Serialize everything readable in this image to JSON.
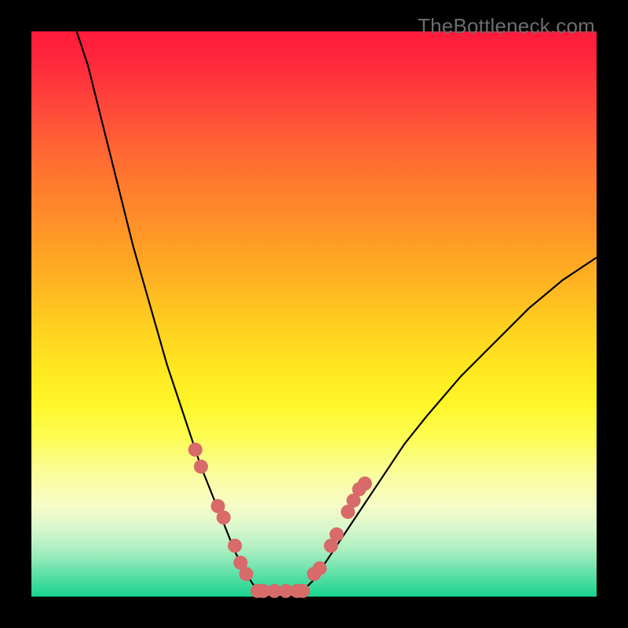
{
  "watermark": "TheBottleneck.com",
  "colors": {
    "frame_bg": "#000000",
    "marker_fill": "#d86a6a",
    "curve_stroke": "#000000"
  },
  "chart_data": {
    "type": "line",
    "title": "",
    "xlabel": "",
    "ylabel": "",
    "xlim": [
      0,
      100
    ],
    "ylim": [
      0,
      100
    ],
    "grid": false,
    "legend": false,
    "description": "V-shaped bottleneck curve with rainbow background; curve drops from top-left to a flat minimum near x≈40-48 at y≈0, then rises to the right. Pink markers are clustered on the two sides of the valley and along the flat minimum.",
    "series": [
      {
        "name": "bottleneck-curve",
        "x": [
          8,
          10,
          12,
          14,
          16,
          18,
          20,
          22,
          24,
          26,
          28,
          30,
          32,
          34,
          36,
          38,
          40,
          42,
          44,
          46,
          48,
          50,
          52,
          54,
          56,
          58,
          62,
          66,
          70,
          76,
          82,
          88,
          94,
          100
        ],
        "y": [
          100,
          94,
          86,
          78,
          70,
          62,
          55,
          48,
          41,
          35,
          29,
          23,
          18,
          13,
          8,
          4,
          1,
          0,
          0,
          0,
          1,
          3,
          6,
          9,
          12,
          15,
          21,
          27,
          32,
          39,
          45,
          51,
          56,
          60
        ]
      }
    ],
    "markers": {
      "name": "cpu-gpu-points",
      "points": [
        {
          "x": 29,
          "y": 26
        },
        {
          "x": 30,
          "y": 23
        },
        {
          "x": 33,
          "y": 16
        },
        {
          "x": 34,
          "y": 14
        },
        {
          "x": 36,
          "y": 9
        },
        {
          "x": 37,
          "y": 6
        },
        {
          "x": 38,
          "y": 4
        },
        {
          "x": 40,
          "y": 1
        },
        {
          "x": 41,
          "y": 1
        },
        {
          "x": 43,
          "y": 1
        },
        {
          "x": 45,
          "y": 1
        },
        {
          "x": 47,
          "y": 1
        },
        {
          "x": 48,
          "y": 1
        },
        {
          "x": 50,
          "y": 4
        },
        {
          "x": 51,
          "y": 5
        },
        {
          "x": 53,
          "y": 9
        },
        {
          "x": 54,
          "y": 11
        },
        {
          "x": 56,
          "y": 15
        },
        {
          "x": 57,
          "y": 17
        },
        {
          "x": 58,
          "y": 19
        },
        {
          "x": 59,
          "y": 20
        }
      ]
    }
  }
}
